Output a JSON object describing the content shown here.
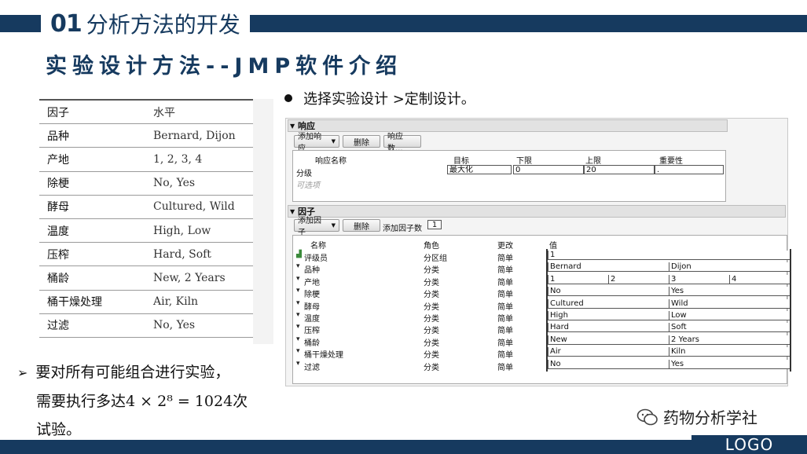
{
  "header": {
    "number": "01",
    "title": "分析方法的开发",
    "subtitle": "实验设计方法--JMP软件介绍"
  },
  "factor_table": {
    "headers": [
      "因子",
      "水平"
    ],
    "rows": [
      [
        "品种",
        "Bernard, Dijon"
      ],
      [
        "产地",
        "1, 2, 3, 4"
      ],
      [
        "除梗",
        "No, Yes"
      ],
      [
        "酵母",
        "Cultured, Wild"
      ],
      [
        "温度",
        "High, Low"
      ],
      [
        "压榨",
        "Hard, Soft"
      ],
      [
        "桶龄",
        "New, 2 Years"
      ],
      [
        "桶干燥处理",
        "Air, Kiln"
      ],
      [
        "过滤",
        "No, Yes"
      ]
    ]
  },
  "instruction": "选择实验设计 >定制设计。",
  "note": {
    "arrow": "➢",
    "line1": "要对所有可能组合进行实验，",
    "line2_a": "需要执行多达",
    "line2_math": "4 × 2⁸ = 1024",
    "line2_b": "次",
    "line3": "试验。"
  },
  "jmp": {
    "responses": {
      "header": "响应",
      "buttons": {
        "add": "添加响应",
        "remove": "删除",
        "count": "响应数..."
      },
      "columns": [
        "响应名称",
        "目标",
        "下限",
        "上限",
        "重要性"
      ],
      "row": {
        "name": "分级",
        "goal": "最大化",
        "lower": "0",
        "upper": "20",
        "importance": "."
      },
      "optional": "可选项"
    },
    "factors": {
      "header": "因子",
      "buttons": {
        "add": "添加因子",
        "remove": "删除",
        "add_n_label": "添加因子数",
        "add_n_value": "1"
      },
      "columns": [
        "名称",
        "角色",
        "更改",
        "值"
      ],
      "rows": [
        {
          "name": "评级员",
          "role": "分区组",
          "change": "简单",
          "values": [
            "1"
          ]
        },
        {
          "name": "品种",
          "role": "分类",
          "change": "简单",
          "values": [
            "Bernard",
            "Dijon"
          ]
        },
        {
          "name": "产地",
          "role": "分类",
          "change": "简单",
          "values": [
            "1",
            "2",
            "3",
            "4"
          ]
        },
        {
          "name": "除梗",
          "role": "分类",
          "change": "简单",
          "values": [
            "No",
            "Yes"
          ]
        },
        {
          "name": "酵母",
          "role": "分类",
          "change": "简单",
          "values": [
            "Cultured",
            "Wild"
          ]
        },
        {
          "name": "温度",
          "role": "分类",
          "change": "简单",
          "values": [
            "High",
            "Low"
          ]
        },
        {
          "name": "压榨",
          "role": "分类",
          "change": "简单",
          "values": [
            "Hard",
            "Soft"
          ]
        },
        {
          "name": "桶龄",
          "role": "分类",
          "change": "简单",
          "values": [
            "New",
            "2 Years"
          ]
        },
        {
          "name": "桶干燥处理",
          "role": "分类",
          "change": "简单",
          "values": [
            "Air",
            "Kiln"
          ]
        },
        {
          "name": "过滤",
          "role": "分类",
          "change": "简单",
          "values": [
            "No",
            "Yes"
          ]
        }
      ]
    }
  },
  "watermark": "药物分析学社",
  "logo": "LOGO",
  "colors": {
    "brand": "#163a5f"
  }
}
